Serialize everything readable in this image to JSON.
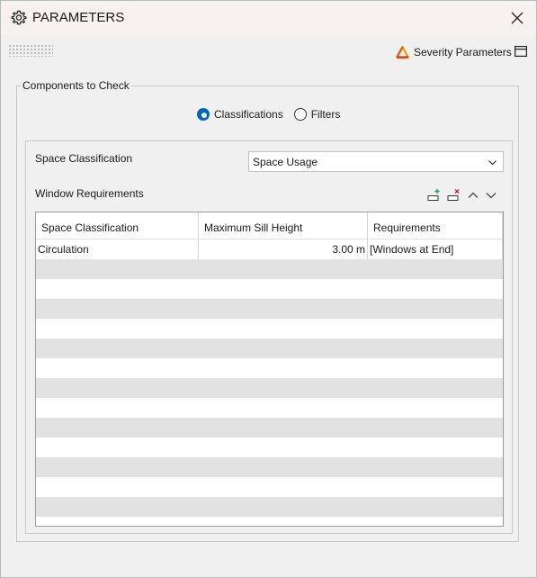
{
  "window": {
    "title": "PARAMETERS"
  },
  "toolbar": {
    "severity_label": "Severity Parameters"
  },
  "group": {
    "legend": "Components to Check",
    "radio_options": [
      {
        "label": "Classifications",
        "selected": true
      },
      {
        "label": "Filters",
        "selected": false
      }
    ]
  },
  "form": {
    "space_classification_label": "Space Classification",
    "space_classification_value": "Space Usage",
    "window_requirements_label": "Window Requirements"
  },
  "table": {
    "columns": [
      "Space Classification",
      "Maximum Sill Height",
      "Requirements"
    ],
    "rows": [
      [
        "Circulation",
        "3.00 m",
        "[Windows at End]"
      ]
    ]
  },
  "colors": {
    "accent": "#0067c0",
    "stripe": "#e2e2e2",
    "add_icon": "#1aa34a",
    "remove_icon": "#d42020"
  },
  "icons": [
    "gear-icon",
    "close-icon",
    "severity-triangle-icon",
    "panel-toggle-icon",
    "chevron-down-icon",
    "add-row-icon",
    "remove-row-icon",
    "move-up-icon",
    "move-down-icon"
  ]
}
